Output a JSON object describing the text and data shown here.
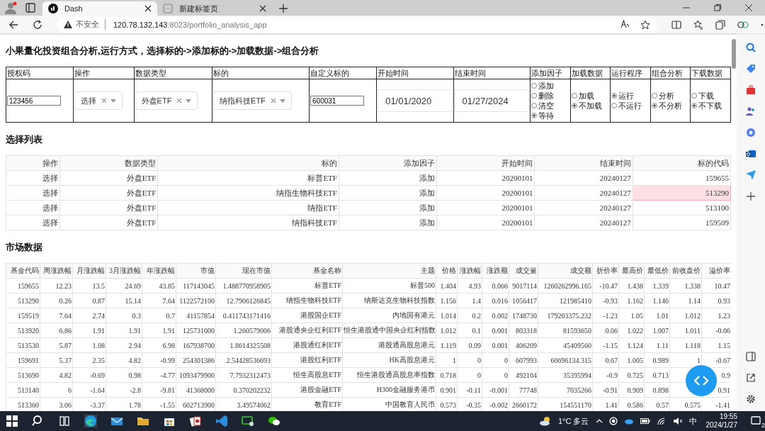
{
  "browser": {
    "tabs": [
      {
        "title": "Dash",
        "selected": true
      },
      {
        "title": "新建标签页",
        "selected": false
      }
    ],
    "address": {
      "insecure_label": "不安全",
      "host": "120.78.132.143",
      "path": ":8023/portfolio_analysis_app"
    }
  },
  "page": {
    "title": "小果量化投资组合分析,运行方式，选择标的->添加标的->加载数据->组合分析",
    "form": {
      "headers": [
        "授权码",
        "操作",
        "数据类型",
        "标的",
        "自定义标的",
        "开始时间",
        "结束时间",
        "添加因子",
        "加载数据",
        "运行程序",
        "组合分析",
        "下载数据"
      ],
      "cells": [
        {
          "kind": "input",
          "value": "123456"
        },
        {
          "kind": "dropdown",
          "value": "选择"
        },
        {
          "kind": "dropdown",
          "value": "外盘ETF"
        },
        {
          "kind": "dropdown",
          "value": "纳指科技ETF"
        },
        {
          "kind": "input",
          "value": "600031"
        },
        {
          "kind": "date",
          "value": "01/01/2020"
        },
        {
          "kind": "date",
          "value": "01/27/2024"
        },
        {
          "kind": "radio",
          "options": [
            {
              "label": "添加",
              "selected": false
            },
            {
              "label": "删除",
              "selected": false
            },
            {
              "label": "清空",
              "selected": false
            },
            {
              "label": "等待",
              "selected": true
            }
          ]
        },
        {
          "kind": "radio",
          "options": [
            {
              "label": "加载",
              "selected": false
            },
            {
              "label": "不加载",
              "selected": true
            }
          ]
        },
        {
          "kind": "radio",
          "options": [
            {
              "label": "运行",
              "selected": true
            },
            {
              "label": "不运行",
              "selected": false
            }
          ]
        },
        {
          "kind": "radio",
          "options": [
            {
              "label": "分析",
              "selected": false
            },
            {
              "label": "不分析",
              "selected": true
            }
          ]
        },
        {
          "kind": "radio",
          "options": [
            {
              "label": "下载",
              "selected": false
            },
            {
              "label": "不下载",
              "selected": true
            }
          ]
        }
      ]
    },
    "selection_list": {
      "title": "选择列表",
      "columns": [
        "操作",
        "数据类型",
        "标的",
        "添加因子",
        "开始时间",
        "结束时间",
        "标的代码"
      ],
      "rows": [
        {
          "cells": [
            "选择",
            "外盘ETF",
            "标普ETF",
            "添加",
            "20200101",
            "20240127",
            "159655"
          ],
          "code_selected": false
        },
        {
          "cells": [
            "选择",
            "外盘ETF",
            "纳指生物科技ETF",
            "添加",
            "20200101",
            "20240127",
            "513290"
          ],
          "code_selected": true
        },
        {
          "cells": [
            "选择",
            "外盘ETF",
            "纳指ETF",
            "添加",
            "20200101",
            "20240127",
            "513100"
          ],
          "code_selected": false
        },
        {
          "cells": [
            "选择",
            "外盘ETF",
            "纳指科技ETF",
            "添加",
            "20200101",
            "20240127",
            "159509"
          ],
          "code_selected": false
        }
      ]
    },
    "market_data": {
      "title": "市场数据",
      "columns": [
        "基金代码",
        "周涨跌幅",
        "月涨跌幅",
        "3月涨跌幅",
        "年涨跌幅",
        "市值",
        "现在市值",
        "基金名称",
        "主题",
        "价格",
        "涨跌幅",
        "涨跌额",
        "成交量",
        "成交额",
        "折价率",
        "最高价",
        "最低价",
        "前收盘价",
        "溢价率"
      ],
      "rows": [
        [
          "159655",
          "12.23",
          "13.5",
          "24.69",
          "43.85",
          "117143045",
          "1.488770958905",
          "标普ETF",
          "标普500",
          "1.404",
          "4.93",
          "0.066",
          "9017114",
          "1260262996.165",
          "-10.47",
          "1.438",
          "1.339",
          "1.338",
          "10.47"
        ],
        [
          "513290",
          "0.26",
          "0.87",
          "15.14",
          "7.64",
          "1122572100",
          "12.7906126845",
          "纳指生物科技ETF",
          "纳斯达克生物科技指数",
          "1.156",
          "1.4",
          "0.016",
          "1056417",
          "121985410",
          "-0.93",
          "1.162",
          "1.146",
          "1.14",
          "0.93"
        ],
        [
          "159519",
          "7.64",
          "2.74",
          "0.3",
          "0.7",
          "41157854",
          "0.411743171416",
          "港股国企ETF",
          "内地国有港元",
          "1.014",
          "0.2",
          "0.002",
          "1748730",
          "179203375.232",
          "-1.23",
          "1.05",
          "1.01",
          "1.012",
          "1.23"
        ],
        [
          "513920",
          "6.86",
          "1.91",
          "1.91",
          "1.91",
          "125731000",
          "1.260579006",
          "港股通央企红利ETF",
          "恒生港股通中国央企红利指数",
          "1.012",
          "0.1",
          "0.001",
          "803318",
          "81593650",
          "0.06",
          "1.022",
          "1.007",
          "1.011",
          "-0.06"
        ],
        [
          "513530",
          "5.87",
          "1.08",
          "2.94",
          "6.98",
          "167938700",
          "1.8614325508",
          "港股通红利ETF",
          "港股通高股息港元",
          "1.119",
          "0.09",
          "0.001",
          "406209",
          "45409560",
          "-1.15",
          "1.124",
          "1.11",
          "1.118",
          "1.15"
        ],
        [
          "159691",
          "5.37",
          "2.35",
          "4.82",
          "-0.99",
          "254301386",
          "2.54428536693",
          "港股红利ETF",
          "HK高股息港元",
          "1",
          "0",
          "0",
          "607993",
          "60696134.315",
          "0.67",
          "1.005",
          "0.989",
          "1",
          "-0.67"
        ],
        [
          "513690",
          "4.82",
          "-0.69",
          "0.98",
          "-4.77",
          "1093479900",
          "7.7932312473",
          "恒生高股息ETF",
          "恒生港股通高股息率指数",
          "0.718",
          "0",
          "0",
          "492104",
          "35395994",
          "-0.9",
          "0.725",
          "0.713",
          null,
          "0.9"
        ],
        [
          "513140",
          "6",
          "-1.64",
          "-2.8",
          "-9.81",
          "41368000",
          "0.370202232",
          "港股金融ETF",
          "H300金融服务港币",
          "0.901",
          "-0.11",
          "-0.001",
          "77748",
          "7035266",
          "-0.91",
          "0.909",
          "0.898",
          null,
          "0.91"
        ],
        [
          "513360",
          "3.06",
          "-3.37",
          "1.78",
          "-1.55",
          "602713900",
          "3.49574062",
          "教育ETF",
          "中国教育人民币",
          "0.573",
          "-0.35",
          "-0.002",
          "2660172",
          "154551170",
          "1.41",
          "0.586",
          "0.57",
          "0.575",
          "-1.41"
        ]
      ]
    }
  },
  "taskbar": {
    "weather": "1°C 多云",
    "ime": "中",
    "time": "19:55",
    "date": "2024/1/27",
    "notifications": "2"
  }
}
